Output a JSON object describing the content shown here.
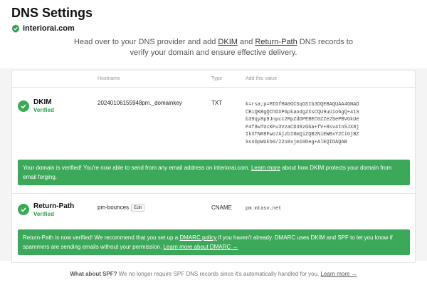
{
  "page": {
    "title": "DNS Settings",
    "domain": "interiorai.com"
  },
  "intro": {
    "text_before": "Head over to your DNS provider and add ",
    "dkim_link": "DKIM",
    "and_text": " and ",
    "returnpath_link": "Return-Path",
    "text_after": " DNS records to verify your domain and ensure effective delivery."
  },
  "table": {
    "headers": {
      "name": "",
      "hostname": "Hostname",
      "type": "Type",
      "value": "Add this value"
    }
  },
  "records": [
    {
      "name": "DKIM",
      "status": "Verified",
      "hostname": "20240106155948pm._domainkey",
      "type": "TXT",
      "value": "k=rsa;p=MIGfMA0GCSqGSIb3DQEBAQUAA4GNAD\nCBiQKBgQChDXPGpkaodgZXsCQU9uUio6gQ+41S\nb39qy8p9Jnpcc2MpZdOPEBEC0ZZe2SePBVGkUe\nP4f8wTUcKFu3VzaCD38zGGa+fV+8sv4InSJX8j\nIkXTNR8Fwo7AjzbI8mQiZQB2NiEWBxY2CiGjBZ\nSsnDpWUkb0/22o8xjm10Deg+AlEQIDAQAB",
      "banner": {
        "before": "Your domain is verified! You're now able to send from any email address on interiorai.com. ",
        "link": "Learn more",
        "after": " about how DKIM protects your domain from email forging."
      }
    },
    {
      "name": "Return-Path",
      "status": "Verified",
      "hostname": "pm-bounces",
      "edit_label": "Edit",
      "type": "CNAME",
      "value": "pm.mtasv.net",
      "banner": {
        "before": "Return-Path is now verified! We recommend that you set up a ",
        "link": "DMARC policy",
        "middle": " if you haven't already. DMARC uses DKIM and SPF to let you know if spammers are sending emails without your permission. ",
        "link2": "Learn more about DMARC →"
      }
    }
  ],
  "footer": {
    "bold": "What about SPF?",
    "text": " We no longer require SPF DNS records since it's automatically handled for you. ",
    "link": "Learn more →"
  },
  "colors": {
    "success": "#3ca859",
    "verified_text": "#2e9d4d"
  }
}
